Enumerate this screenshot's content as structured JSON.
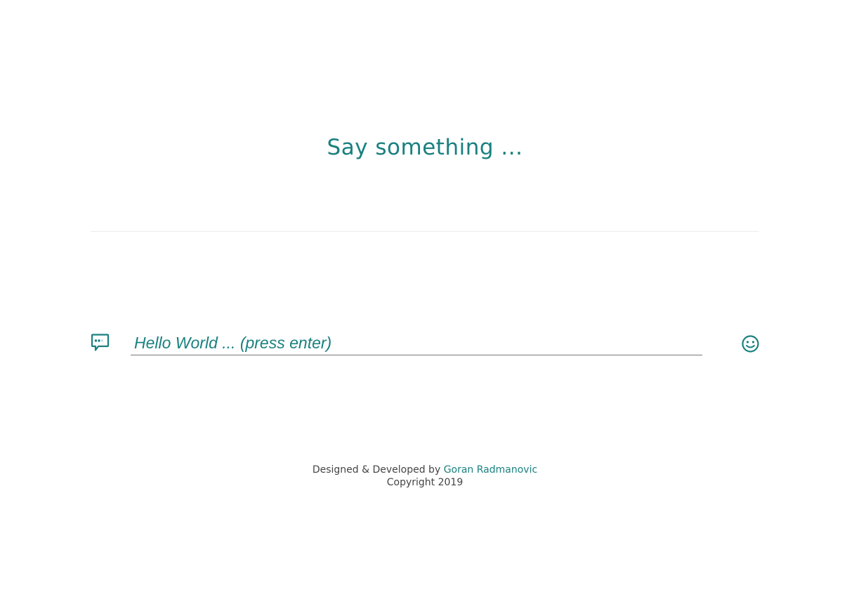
{
  "header": {
    "title": "Say something ..."
  },
  "composer": {
    "placeholder": "Hello World ... (press enter)",
    "value": "",
    "left_icon": "chat-bubble-icon",
    "right_icon": "smiley-icon"
  },
  "footer": {
    "credit_prefix": "Designed & Developed by",
    "author_link": "Goran Radmanovic",
    "copyright": "Copyright 2019"
  },
  "theme": {
    "accent": "#1a8080",
    "text": "#444444",
    "divider": "#ececec"
  }
}
